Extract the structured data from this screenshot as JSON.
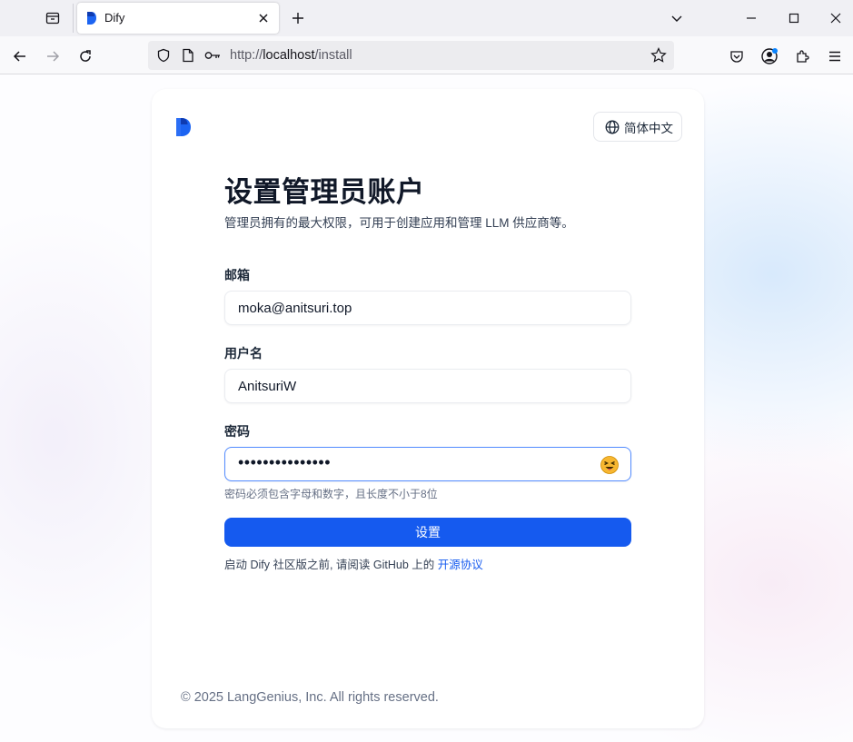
{
  "browser": {
    "tab": {
      "title": "Dify"
    },
    "url": {
      "scheme": "http://",
      "host": "localhost",
      "path": "/install"
    }
  },
  "page": {
    "language": "简体中文",
    "title": "设置管理员账户",
    "subtitle": "管理员拥有的最大权限，可用于创建应用和管理 LLM 供应商等。",
    "email": {
      "label": "邮箱",
      "value": "moka@anitsuri.top"
    },
    "username": {
      "label": "用户名",
      "value": "AnitsuriW"
    },
    "password": {
      "label": "密码",
      "value": "•••••••••••••••",
      "hint": "密码必须包含字母和数字，且长度不小于8位"
    },
    "submit_label": "设置",
    "notice_prefix": "启动 Dify 社区版之前, 请阅读 GitHub 上的 ",
    "notice_link": "开源协议",
    "footer": "© 2025 LangGenius, Inc. All rights reserved."
  },
  "colors": {
    "primary": "#155aef",
    "focus_border": "#528bff"
  }
}
